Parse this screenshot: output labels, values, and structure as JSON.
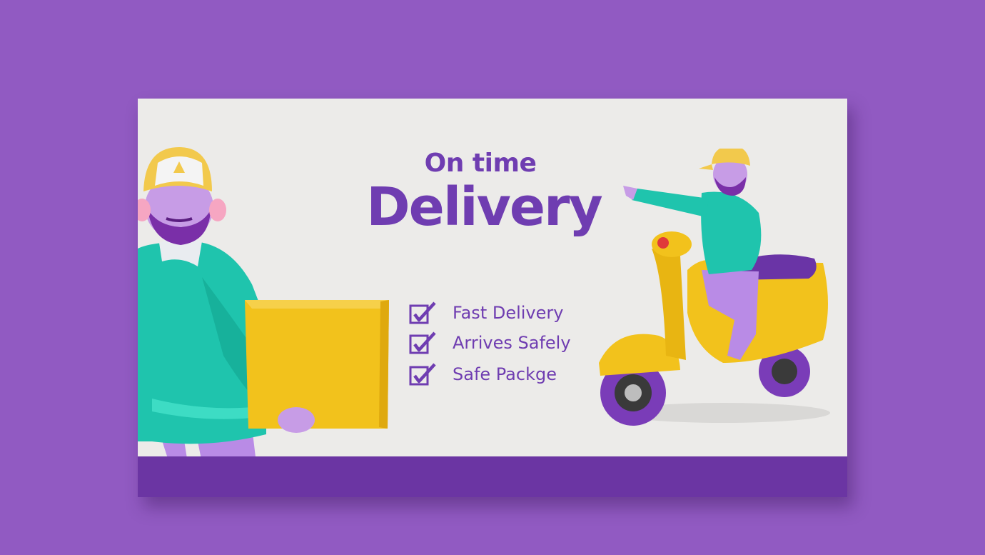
{
  "headline": {
    "small": "On time",
    "big": "Delivery"
  },
  "features": [
    {
      "label": "Fast Delivery",
      "icon": "checkbox-icon"
    },
    {
      "label": "Arrives Safely",
      "icon": "checkbox-icon"
    },
    {
      "label": "Safe Packge",
      "icon": "checkbox-icon"
    }
  ],
  "colors": {
    "background": "#915ac2",
    "card": "#ecebe9",
    "footer": "#6b35a3",
    "text": "#6f3db1"
  }
}
